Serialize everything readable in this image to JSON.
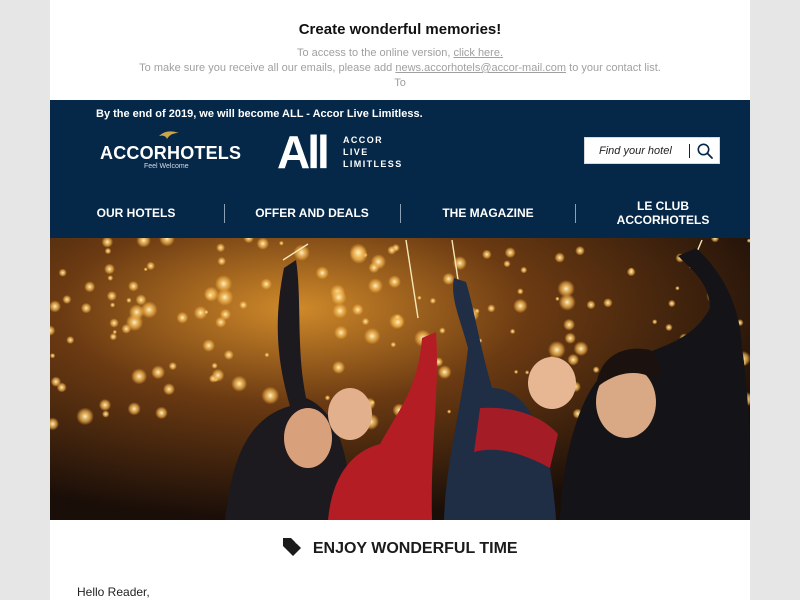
{
  "preheader": {
    "title": "Create wonderful memories!",
    "online_text": "To access to the online version,",
    "online_link": "click here.",
    "contact_text_before": "To make sure you receive all our emails, please add",
    "contact_email": "news.accorhotels@accor-mail.com",
    "contact_text_after": "to your contact list.",
    "to_line": "To"
  },
  "header": {
    "tagline": "By the end of 2019, we will become ALL - Accor Live Limitless.",
    "accor_logo": {
      "name": "ACCORHOTELS",
      "subtitle": "Feel Welcome",
      "icon": "bird-icon"
    },
    "all_logo": {
      "big": "All",
      "words": [
        "ACCOR",
        "LIVE",
        "LIMITLESS"
      ]
    },
    "search": {
      "placeholder": "Find your hotel",
      "value": "",
      "icon": "search-icon"
    },
    "menu": [
      {
        "label": "OUR HOTELS"
      },
      {
        "label": "OFFER AND DEALS"
      },
      {
        "label": "THE MAGAZINE"
      },
      {
        "label": "LE CLUB ACCORHOTELS"
      }
    ]
  },
  "hero": {
    "kind": "photo",
    "subject": "family with sparklers in front of holiday lights"
  },
  "section": {
    "icon": "tag-icon",
    "title": "ENJOY WONDERFUL TIME"
  },
  "body": {
    "greeting": "Hello Reader,"
  },
  "colors": {
    "navy": "#052848",
    "gold": "#c9a54b",
    "background": "#e6e6e6"
  }
}
